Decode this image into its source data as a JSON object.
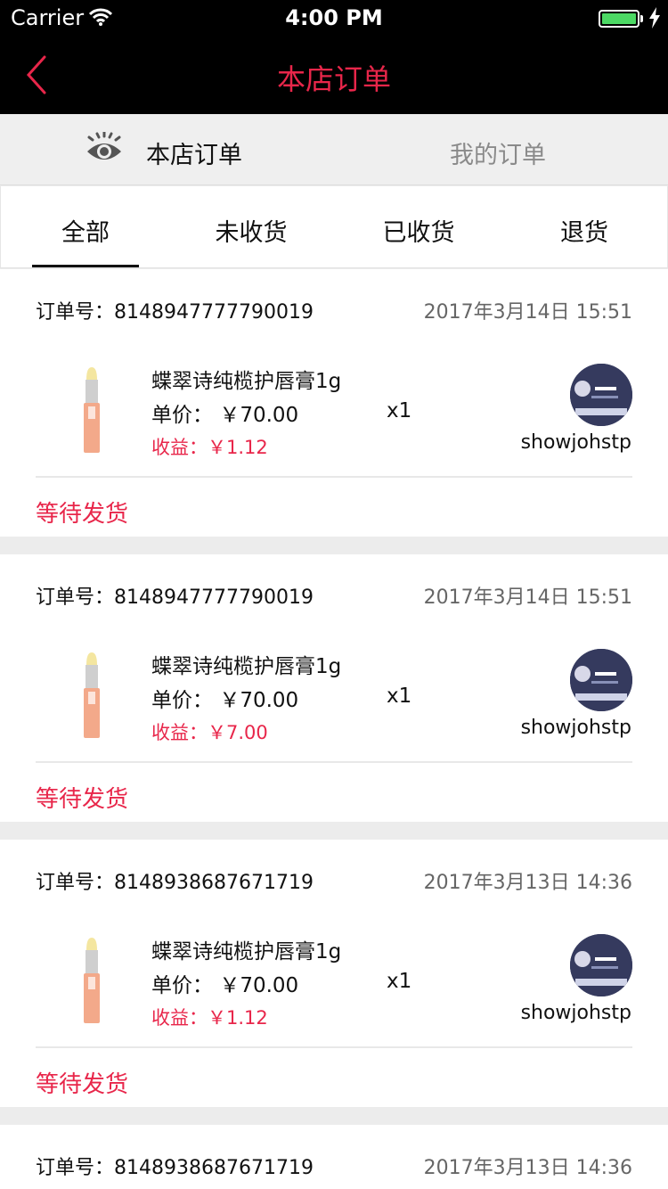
{
  "status_bar": {
    "carrier": "Carrier",
    "time": "4:00 PM",
    "battery_level": 1.0
  },
  "nav": {
    "title": "本店订单",
    "back_icon": "chevron-left-icon",
    "accent_color": "#e8264a"
  },
  "switcher": {
    "eye_icon": "eye-icon",
    "shop_orders": "本店订单",
    "my_orders": "我的订单"
  },
  "tabs": [
    "全部",
    "未收货",
    "已收货",
    "退货"
  ],
  "orders": [
    {
      "number_label": "订单号：",
      "number": "8148947777790019",
      "date": "2017年3月14日 15:51",
      "product": "蝶翠诗纯榄护唇膏1g",
      "price_label": "单价：",
      "price": "￥70.00",
      "qty": "x1",
      "profit_label": "收益：",
      "profit": "￥1.12",
      "user": "showjohstp",
      "status": "等待发货"
    },
    {
      "number_label": "订单号：",
      "number": "8148947777790019",
      "date": "2017年3月14日 15:51",
      "product": "蝶翠诗纯榄护唇膏1g",
      "price_label": "单价：",
      "price": "￥70.00",
      "qty": "x1",
      "profit_label": "收益：",
      "profit": "￥7.00",
      "user": "showjohstp",
      "status": "等待发货"
    },
    {
      "number_label": "订单号：",
      "number": "8148938687671719",
      "date": "2017年3月13日 14:36",
      "product": "蝶翠诗纯榄护唇膏1g",
      "price_label": "单价：",
      "price": "￥70.00",
      "qty": "x1",
      "profit_label": "收益：",
      "profit": "￥1.12",
      "user": "showjohstp",
      "status": "等待发货"
    },
    {
      "number_label": "订单号：",
      "number": "8148938687671719",
      "date": "2017年3月13日 14:36"
    }
  ]
}
